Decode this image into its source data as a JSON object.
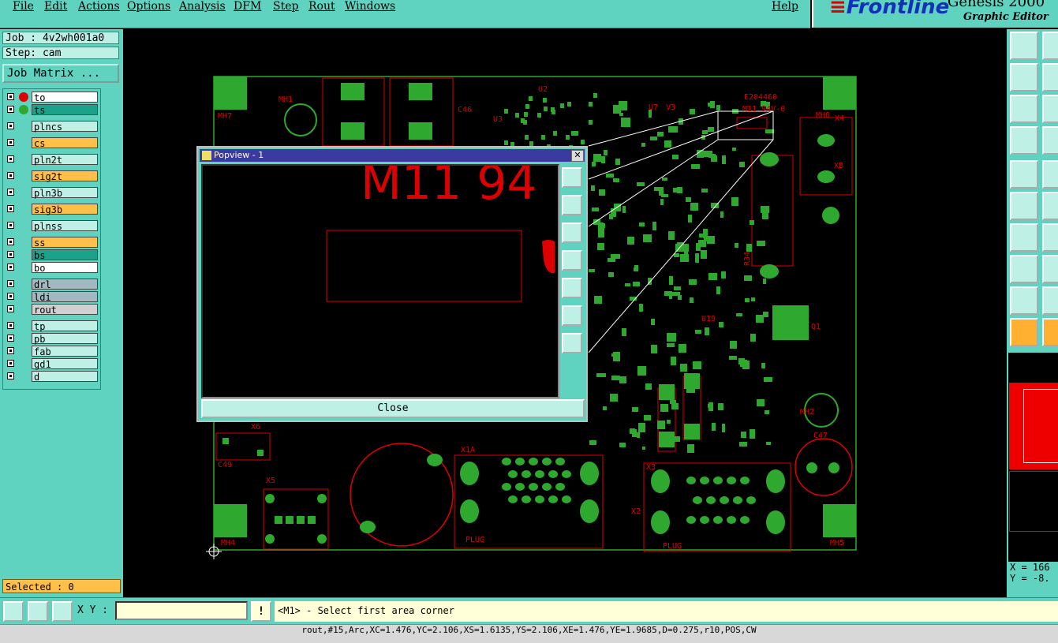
{
  "menu": [
    "File",
    "Edit",
    "Actions",
    "Options",
    "Analysis",
    "DFM",
    "Step",
    "Rout",
    "Windows"
  ],
  "help": "Help",
  "logo": {
    "brand": "Frontline",
    "product": "Genesis 2000",
    "subtitle": "Graphic Editor"
  },
  "job": "Job : 4v2wh001a0",
  "step": "Step: cam",
  "job_matrix": "Job Matrix ...",
  "layers": [
    {
      "name": "to",
      "color": "#ffffff",
      "dot": "#e00000"
    },
    {
      "name": "ts",
      "color": "#1aa38a",
      "dot": "#2fa82f"
    },
    {
      "name": "plncs",
      "color": "#bff0e6",
      "dot": ""
    },
    {
      "name": "cs",
      "color": "#ffc04a",
      "dot": ""
    },
    {
      "name": "pln2t",
      "color": "#bff0e6",
      "dot": ""
    },
    {
      "name": "sig2t",
      "color": "#ffc04a",
      "dot": ""
    },
    {
      "name": "pln3b",
      "color": "#bff0e6",
      "dot": ""
    },
    {
      "name": "sig3b",
      "color": "#ffc04a",
      "dot": ""
    },
    {
      "name": "plnss",
      "color": "#bff0e6",
      "dot": ""
    },
    {
      "name": "ss",
      "color": "#ffc04a",
      "dot": ""
    },
    {
      "name": "bs",
      "color": "#1aa38a",
      "dot": ""
    },
    {
      "name": "bo",
      "color": "#ffffff",
      "dot": ""
    },
    {
      "name": "drl",
      "color": "#a0b8c0",
      "dot": ""
    },
    {
      "name": "ldi",
      "color": "#a0b8c0",
      "dot": ""
    },
    {
      "name": "rout",
      "color": "#d0d0d0",
      "dot": ""
    },
    {
      "name": "tp",
      "color": "#bff0e6",
      "dot": ""
    },
    {
      "name": "pb",
      "color": "#bff0e6",
      "dot": ""
    },
    {
      "name": "fab",
      "color": "#bff0e6",
      "dot": ""
    },
    {
      "name": "gd1",
      "color": "#bff0e6",
      "dot": ""
    },
    {
      "name": "d",
      "color": "#bff0e6",
      "dot": ""
    }
  ],
  "selected": "Selected : 0",
  "popview": {
    "title": "Popview - 1",
    "close": "Close",
    "zoom_text": "M11 94"
  },
  "board_labels": {
    "e204": "E204460",
    "m11": "M11 94V-0",
    "mh1": "MH1",
    "mh2": "MH2",
    "mh4": "MH4",
    "mh5": "MH5",
    "mh6": "MH6",
    "mh7": "MH7",
    "c46": "C46",
    "c47": "C47",
    "c49": "C49",
    "u2": "U2",
    "u3": "U3",
    "u7": "U7",
    "v3": "V3",
    "x4": "X4",
    "xb": "XB",
    "x5": "X5",
    "x6": "X6",
    "x1a": "X1A",
    "x3": "X3",
    "x2": "X2",
    "r34": "R34",
    "q1": "Q1",
    "u19": "U19",
    "plug": "PLUG"
  },
  "xy_label": "X Y :",
  "readout": {
    "x": "X = 166",
    "y": "Y = -8."
  },
  "prompt": "<M1> - Select first area corner",
  "status": "rout,#15,Arc,XC=1.476,YC=2.106,XS=1.6135,YS=2.106,XE=1.476,YE=1.9685,D=0.275,r10,POS,CW"
}
